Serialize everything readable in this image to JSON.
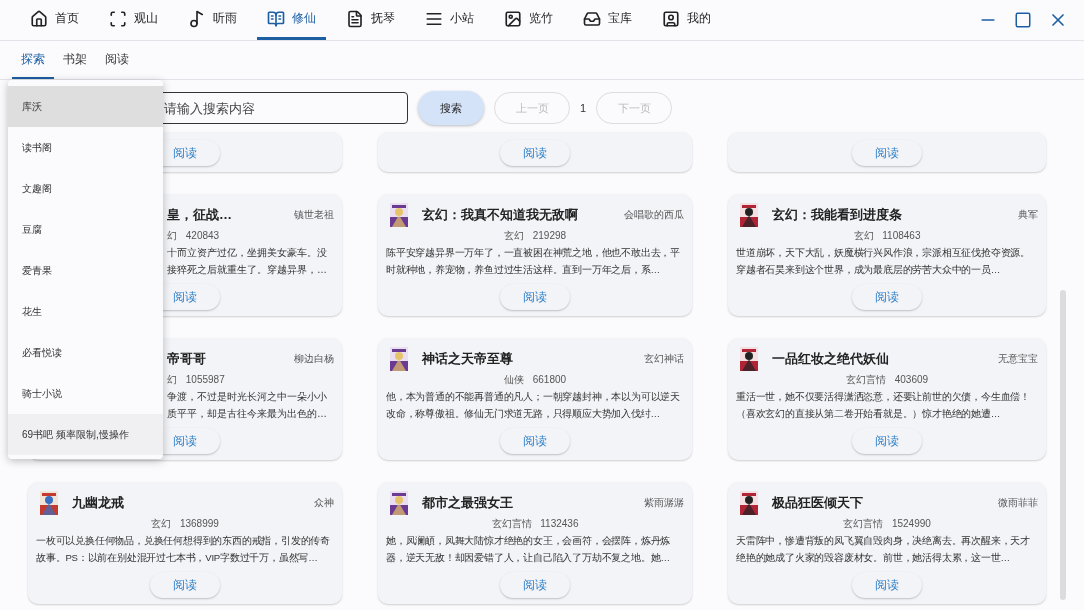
{
  "nav": {
    "items": [
      {
        "label": "首页",
        "selected": false
      },
      {
        "label": "观山",
        "selected": false
      },
      {
        "label": "听雨",
        "selected": false
      },
      {
        "label": "修仙",
        "selected": true
      },
      {
        "label": "抚琴",
        "selected": false
      },
      {
        "label": "小站",
        "selected": false
      },
      {
        "label": "览竹",
        "selected": false
      },
      {
        "label": "宝库",
        "selected": false
      },
      {
        "label": "我的",
        "selected": false
      }
    ]
  },
  "subtabs": [
    {
      "label": "探索",
      "selected": true
    },
    {
      "label": "书架",
      "selected": false
    },
    {
      "label": "阅读",
      "selected": false
    }
  ],
  "search": {
    "placeholder": "请输入搜索内容",
    "button": "搜索",
    "prev": "上一页",
    "page": "1",
    "next": "下一页",
    "prev_disabled": true,
    "next_disabled": true
  },
  "source_menu": [
    {
      "label": "库沃",
      "selected": true,
      "hovered": false
    },
    {
      "label": "读书阁",
      "selected": false,
      "hovered": false
    },
    {
      "label": "文趣阁",
      "selected": false,
      "hovered": false
    },
    {
      "label": "豆腐",
      "selected": false,
      "hovered": false
    },
    {
      "label": "爱青果",
      "selected": false,
      "hovered": false
    },
    {
      "label": "花生",
      "selected": false,
      "hovered": false
    },
    {
      "label": "必看悦读",
      "selected": false,
      "hovered": false
    },
    {
      "label": "骑士小说",
      "selected": false,
      "hovered": false
    },
    {
      "label": "69书吧 频率限制,慢操作",
      "selected": false,
      "hovered": true
    }
  ],
  "books": [
    {
      "kind": "tail",
      "button": "阅读"
    },
    {
      "kind": "tail",
      "button": "阅读"
    },
    {
      "kind": "tail",
      "button": "阅读"
    },
    {
      "kind": "covered",
      "title": "皇，征战…",
      "author": "镇世老祖",
      "category": "幻",
      "count": "420843",
      "desc_lines": [
        "十而立资产过亿，坐拥美女豪车。没",
        "接猝死之后就重生了。穿越异界，…"
      ],
      "button": "阅读"
    },
    {
      "kind": "full",
      "title": "玄幻：我真不知道我无敌啊",
      "author": "会唱歌的西瓜",
      "category": "玄幻",
      "count": "219298",
      "desc": "陈平安穿越异界一万年了，一直被困在神荒之地，他也不敢出去，平时就种地，养宠物，养鱼过过生活这样。直到一万年之后，系…",
      "button": "阅读"
    },
    {
      "kind": "full",
      "title": "玄幻：我能看到进度条",
      "author": "典军",
      "category": "玄幻",
      "count": "1108463",
      "desc": "世道崩坏，天下大乱，妖魔横行兴风作浪，宗派相互征伐抢夺资源。穿越者石昊来到这个世界，成为最底层的劳苦大众中的一员…",
      "button": "阅读"
    },
    {
      "kind": "covered",
      "title": "帝哥哥",
      "author": "柳边白杨",
      "category": "幻",
      "count": "1055987",
      "desc_lines": [
        "争渡，不过是时光长河之中一朵小小",
        "质平平，却是古往今来最为出色的…"
      ],
      "button": "阅读"
    },
    {
      "kind": "full",
      "title": "神话之天帝至尊",
      "author": "玄幻神话",
      "category": "仙侠",
      "count": "661800",
      "desc": "他，本为普通的不能再普通的凡人；一朝穿越封神，本以为可以逆天改命，称尊傲祖。修仙无门求道无路，只得顺应大势加入伐纣…",
      "button": "阅读"
    },
    {
      "kind": "full",
      "title": "一品红妆之绝代妖仙",
      "author": "无意宝宝",
      "category": "玄幻言情",
      "count": "403609",
      "desc": "重活一世，她不仅要活得潇洒恣意，还要让前世的欠债，今生血偿！（喜欢玄幻的直接从第二卷开始看就是。）惊才艳绝的她遭…",
      "button": "阅读"
    },
    {
      "kind": "full",
      "title": "九幽龙戒",
      "author": "众神",
      "category": "玄幻",
      "count": "1368999",
      "desc": "一枚可以兑换任何物品，兑换任何想得到的东西的戒指，引发的传奇故事。PS：以前在别处混开过七本书，VIP字数过千万，虽然写…",
      "button": "阅读"
    },
    {
      "kind": "full",
      "title": "都市之最强女王",
      "author": "紫雨潺潺",
      "category": "玄幻言情",
      "count": "1132436",
      "desc": "她，凤澜頔，凤舞大陆惊才绝艳的女王，会画符，会摆阵，炼丹炼器，逆天无敌！却因爱错了人，让自己陷入了万劫不复之地。她…",
      "button": "阅读"
    },
    {
      "kind": "full",
      "title": "极品狂医倾天下",
      "author": "微雨菲菲",
      "category": "玄幻言情",
      "count": "1524990",
      "desc": "天雷阵中，惨遭背叛的凤飞翼自毁肉身，决绝离去。再次醒来，天才绝艳的她成了火家的毁容废材女。前世，她活得太累，这一世…",
      "button": "阅读"
    }
  ]
}
